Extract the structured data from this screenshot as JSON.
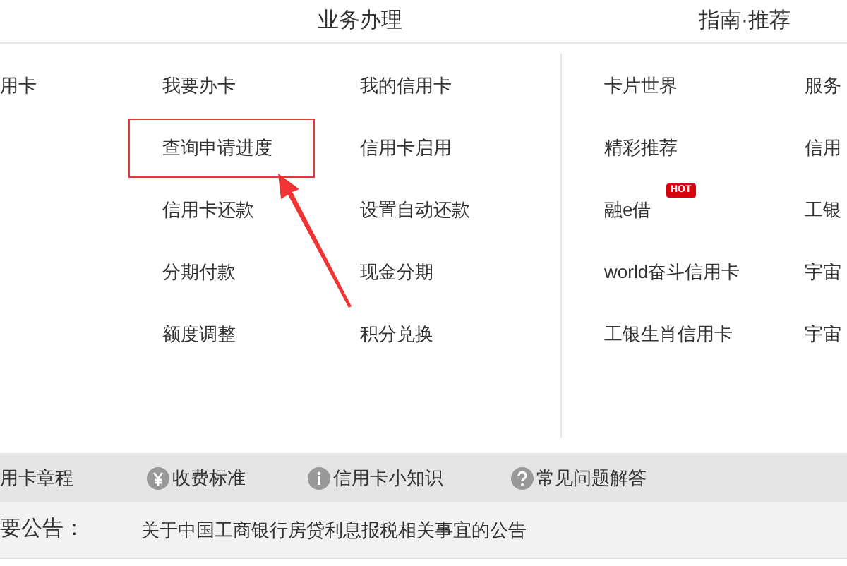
{
  "header": {
    "sections": [
      {
        "title": "业务办理"
      },
      {
        "title": "指南·推荐"
      }
    ]
  },
  "business_columns": [
    {
      "items": [
        {
          "label": "用卡",
          "highlighted": false
        }
      ]
    },
    {
      "items": [
        {
          "label": "我要办卡",
          "highlighted": false
        },
        {
          "label": "查询申请进度",
          "highlighted": true
        },
        {
          "label": "信用卡还款",
          "highlighted": false
        },
        {
          "label": "分期付款",
          "highlighted": false
        },
        {
          "label": "额度调整",
          "highlighted": false
        }
      ]
    },
    {
      "items": [
        {
          "label": "我的信用卡",
          "highlighted": false
        },
        {
          "label": "信用卡启用",
          "highlighted": false
        },
        {
          "label": "设置自动还款",
          "highlighted": false
        },
        {
          "label": "现金分期",
          "highlighted": false
        },
        {
          "label": "积分兑换",
          "highlighted": false
        }
      ]
    }
  ],
  "guide_columns": [
    {
      "items": [
        {
          "label": "卡片世界"
        },
        {
          "label": "精彩推荐"
        },
        {
          "label": "融e借",
          "badge": "HOT"
        },
        {
          "label": "world奋斗信用卡"
        },
        {
          "label": "工银生肖信用卡"
        }
      ]
    },
    {
      "items": [
        {
          "label": "服务"
        },
        {
          "label": "信用"
        },
        {
          "label": "工银"
        },
        {
          "label": "宇宙"
        },
        {
          "label": "宇宙"
        }
      ]
    }
  ],
  "links_bar": [
    {
      "label": "用卡章程",
      "kind": "text"
    },
    {
      "label": "收费标准",
      "kind": "yen"
    },
    {
      "label": "信用卡小知识",
      "kind": "info"
    },
    {
      "label": "常见问题解答",
      "kind": "question"
    }
  ],
  "notice": {
    "label": "要公告：",
    "text": "关于中国工商银行房贷利息报税相关事宜的公告"
  }
}
